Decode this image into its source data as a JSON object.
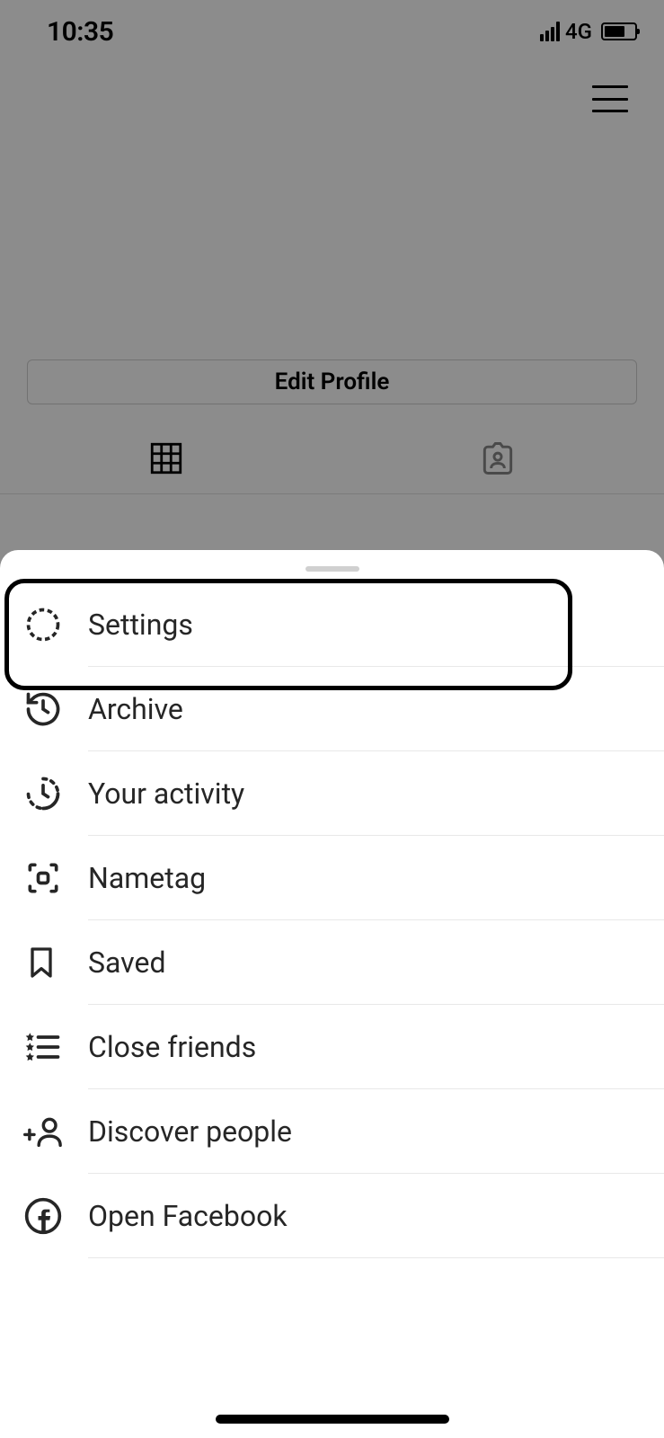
{
  "status": {
    "time": "10:35",
    "network": "4G"
  },
  "profile": {
    "edit_button": "Edit Profile"
  },
  "menu": {
    "items": [
      {
        "label": "Settings"
      },
      {
        "label": "Archive"
      },
      {
        "label": "Your activity"
      },
      {
        "label": "Nametag"
      },
      {
        "label": "Saved"
      },
      {
        "label": "Close friends"
      },
      {
        "label": "Discover people"
      },
      {
        "label": "Open Facebook"
      }
    ]
  }
}
